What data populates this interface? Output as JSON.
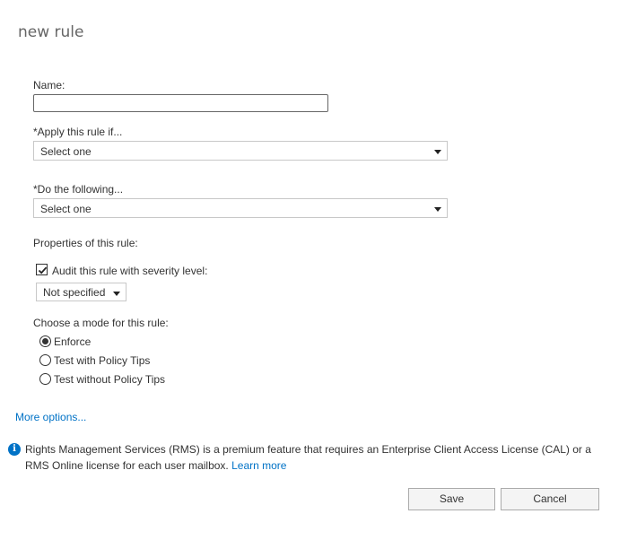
{
  "dialog": {
    "title": "new rule"
  },
  "form": {
    "name_label": "Name:",
    "name_value": "",
    "apply_label": "*Apply this rule if...",
    "apply_value": "Select one",
    "do_label": "*Do the following...",
    "do_value": "Select one",
    "properties_label": "Properties of this rule:",
    "audit_label": "Audit this rule with severity level:",
    "audit_checked": true,
    "severity_value": "Not specified",
    "mode_label": "Choose a mode for this rule:",
    "modes": [
      {
        "label": "Enforce",
        "selected": true
      },
      {
        "label": "Test with Policy Tips",
        "selected": false
      },
      {
        "label": "Test without Policy Tips",
        "selected": false
      }
    ],
    "more_options": "More options..."
  },
  "info": {
    "icon": "info-icon",
    "text": "Rights Management Services (RMS) is a premium feature that requires an Enterprise Client Access License (CAL) or a RMS Online license for each user mailbox.",
    "link": "Learn more"
  },
  "buttons": {
    "save": "Save",
    "cancel": "Cancel"
  },
  "colors": {
    "link": "#0072c6",
    "text": "#333333",
    "title": "#666666"
  }
}
